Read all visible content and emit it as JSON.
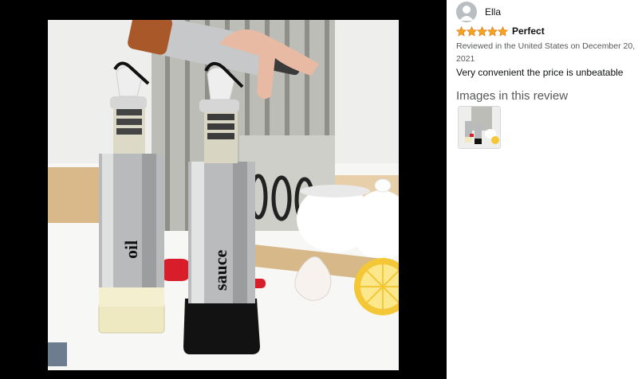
{
  "viewer": {
    "image_label": "Customer review image: stainless steel oil and sauce dispenser bottles",
    "bottle_labels": [
      "oil",
      "sauce"
    ]
  },
  "review": {
    "reviewer_name": "Ella",
    "rating": 5,
    "rating_max": 5,
    "title": "Perfect",
    "meta": "Reviewed in the United States on December 20, 2021",
    "body": "Very convenient the price is unbeatable",
    "images_heading": "Images in this review"
  },
  "colors": {
    "star": "#f4a41c",
    "viewer_background": "#000000",
    "meta_text": "#565959"
  },
  "icons": {
    "avatar": "person-silhouette-icon",
    "star": "star-icon",
    "thumbnail": "review-image-thumbnail"
  }
}
